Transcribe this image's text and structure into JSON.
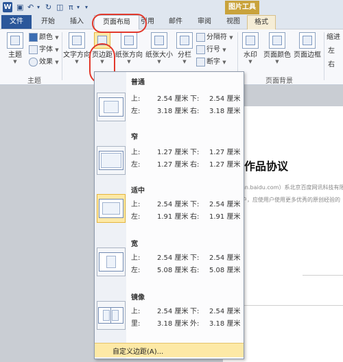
{
  "qat": {
    "more_label": "π",
    "dropdown_label": "▾"
  },
  "context_tab": {
    "label": "图片工具"
  },
  "tabs": {
    "file": "文件",
    "home": "开始",
    "insert": "插入",
    "page_layout": "页面布局",
    "references": "引用",
    "mailings": "邮件",
    "review": "审阅",
    "view": "视图",
    "format": "格式"
  },
  "ribbon": {
    "themes": {
      "theme_button": "主题",
      "colors": "颜色",
      "fonts": "字体",
      "effects": "效果",
      "group_label": "主题"
    },
    "page_setup": {
      "text_direction": "文字方向",
      "margins": "页边距",
      "orientation": "纸张方向",
      "size": "纸张大小",
      "columns": "分栏",
      "breaks": "分隔符",
      "line_numbers": "行号",
      "hyphenation": "断字"
    },
    "page_background": {
      "watermark": "水印",
      "page_color": "页面颜色",
      "page_borders": "页面边框",
      "group_label": "页面背景"
    },
    "indent_label": "缩进",
    "left_label": "左",
    "right_label": "右"
  },
  "margins_menu": {
    "options": [
      {
        "name": "普通",
        "top_label": "上:",
        "top": "2.54 厘米",
        "bottom_label": "下:",
        "bottom": "2.54 厘米",
        "left_label": "左:",
        "left": "3.18 厘米",
        "right_label": "右:",
        "right": "3.18 厘米"
      },
      {
        "name": "窄",
        "top_label": "上:",
        "top": "1.27 厘米",
        "bottom_label": "下:",
        "bottom": "1.27 厘米",
        "left_label": "左:",
        "left": "1.27 厘米",
        "right_label": "右:",
        "right": "1.27 厘米"
      },
      {
        "name": "适中",
        "top_label": "上:",
        "top": "2.54 厘米",
        "bottom_label": "下:",
        "bottom": "2.54 厘米",
        "left_label": "左:",
        "left": "1.91 厘米",
        "right_label": "右:",
        "right": "1.91 厘米"
      },
      {
        "name": "宽",
        "top_label": "上:",
        "top": "2.54 厘米",
        "bottom_label": "下:",
        "bottom": "2.54 厘米",
        "left_label": "左:",
        "left": "5.08 厘米",
        "right_label": "右:",
        "right": "5.08 厘米"
      },
      {
        "name": "镜像",
        "top_label": "上:",
        "top": "2.54 厘米",
        "bottom_label": "下:",
        "bottom": "2.54 厘米",
        "left_label": "里:",
        "left": "3.18 厘米",
        "right_label": "外:",
        "right": "3.18 厘米"
      }
    ],
    "custom": "自定义边距(A)..."
  },
  "document": {
    "title": "作品协议",
    "line1": "an.baidu.com）系北京百度网讯科技有限公",
    "line2": "户，应使用户使用更多优秀的原创经验的"
  },
  "colors": {
    "accent": "#2b579a",
    "highlight": "#e2382b",
    "hover": "#fde9a6"
  }
}
